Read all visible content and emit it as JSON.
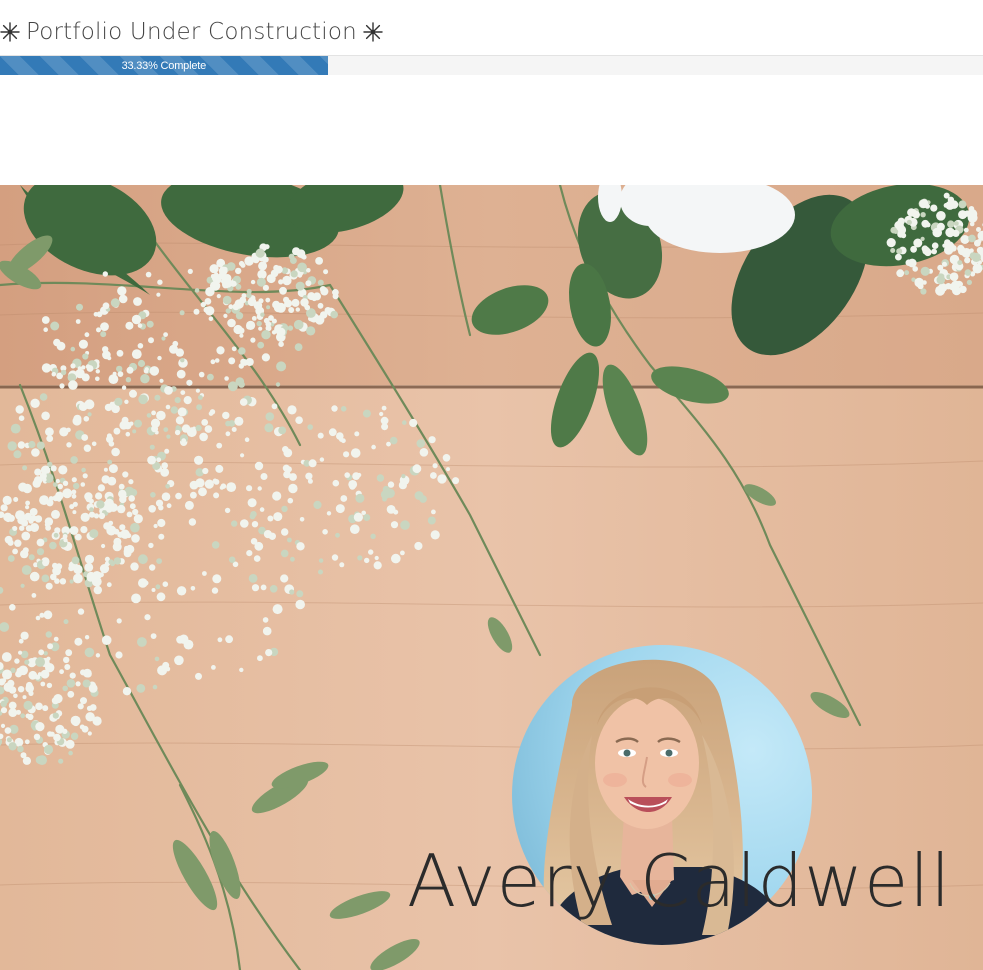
{
  "header": {
    "title": "Portfolio Under Construction",
    "left_icon": "sparkle-icon",
    "right_icon": "sparkle-icon"
  },
  "progress": {
    "percent": 33.33,
    "label": "33.33% Complete",
    "fill_color": "#337ab7",
    "track_color": "#f5f5f5"
  },
  "hero": {
    "background_icon": "wildflowers-on-wood-photo",
    "profile_photo_icon": "profile-photo",
    "name": "Avery Caldwell",
    "name_color": "#2b2b2b"
  }
}
